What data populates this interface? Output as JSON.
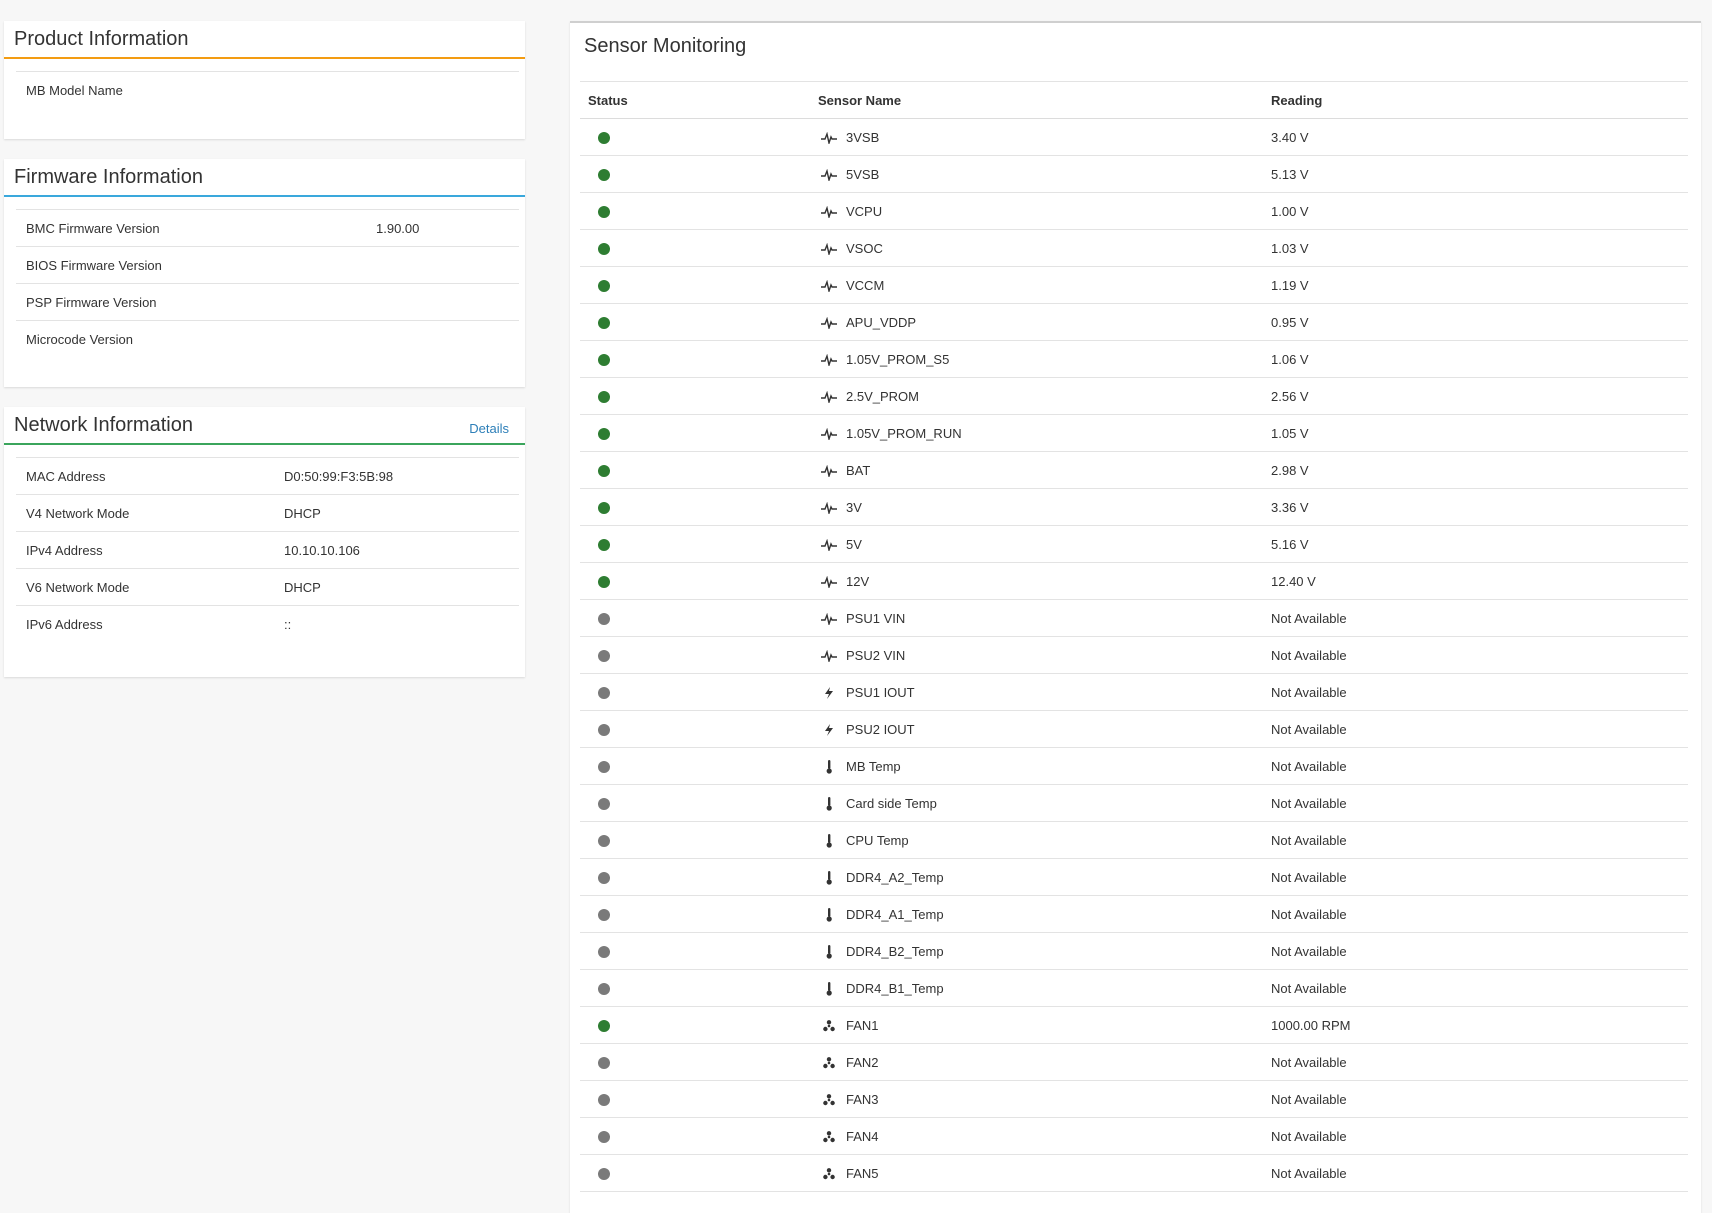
{
  "product": {
    "title": "Product Information",
    "rows": [
      {
        "label": "MB Model Name",
        "value": ""
      }
    ]
  },
  "firmware": {
    "title": "Firmware Information",
    "rows": [
      {
        "label": "BMC Firmware Version",
        "value": "1.90.00"
      },
      {
        "label": "BIOS Firmware Version",
        "value": ""
      },
      {
        "label": "PSP Firmware Version",
        "value": ""
      },
      {
        "label": "Microcode Version",
        "value": ""
      }
    ]
  },
  "network": {
    "title": "Network Information",
    "details_link": "Details",
    "rows": [
      {
        "label": "MAC Address",
        "value": "D0:50:99:F3:5B:98"
      },
      {
        "label": "V4 Network Mode",
        "value": "DHCP"
      },
      {
        "label": "IPv4 Address",
        "value": "10.10.10.106"
      },
      {
        "label": "V6 Network Mode",
        "value": "DHCP"
      },
      {
        "label": "IPv6 Address",
        "value": "::"
      }
    ]
  },
  "sensors": {
    "title": "Sensor Monitoring",
    "columns": {
      "status": "Status",
      "name": "Sensor Name",
      "reading": "Reading"
    },
    "status_colors": {
      "ok": "#2e7d32",
      "na": "#7a7a7a"
    },
    "rows": [
      {
        "status": "ok",
        "icon": "voltage-icon",
        "name": "3VSB",
        "reading": "3.40 V"
      },
      {
        "status": "ok",
        "icon": "voltage-icon",
        "name": "5VSB",
        "reading": "5.13 V"
      },
      {
        "status": "ok",
        "icon": "voltage-icon",
        "name": "VCPU",
        "reading": "1.00 V"
      },
      {
        "status": "ok",
        "icon": "voltage-icon",
        "name": "VSOC",
        "reading": "1.03 V"
      },
      {
        "status": "ok",
        "icon": "voltage-icon",
        "name": "VCCM",
        "reading": "1.19 V"
      },
      {
        "status": "ok",
        "icon": "voltage-icon",
        "name": "APU_VDDP",
        "reading": "0.95 V"
      },
      {
        "status": "ok",
        "icon": "voltage-icon",
        "name": "1.05V_PROM_S5",
        "reading": "1.06 V"
      },
      {
        "status": "ok",
        "icon": "voltage-icon",
        "name": "2.5V_PROM",
        "reading": "2.56 V"
      },
      {
        "status": "ok",
        "icon": "voltage-icon",
        "name": "1.05V_PROM_RUN",
        "reading": "1.05 V"
      },
      {
        "status": "ok",
        "icon": "voltage-icon",
        "name": "BAT",
        "reading": "2.98 V"
      },
      {
        "status": "ok",
        "icon": "voltage-icon",
        "name": "3V",
        "reading": "3.36 V"
      },
      {
        "status": "ok",
        "icon": "voltage-icon",
        "name": "5V",
        "reading": "5.16 V"
      },
      {
        "status": "ok",
        "icon": "voltage-icon",
        "name": "12V",
        "reading": "12.40 V"
      },
      {
        "status": "na",
        "icon": "voltage-icon",
        "name": "PSU1 VIN",
        "reading": "Not Available"
      },
      {
        "status": "na",
        "icon": "voltage-icon",
        "name": "PSU2 VIN",
        "reading": "Not Available"
      },
      {
        "status": "na",
        "icon": "current-icon",
        "name": "PSU1 IOUT",
        "reading": "Not Available"
      },
      {
        "status": "na",
        "icon": "current-icon",
        "name": "PSU2 IOUT",
        "reading": "Not Available"
      },
      {
        "status": "na",
        "icon": "thermometer-icon",
        "name": "MB Temp",
        "reading": "Not Available"
      },
      {
        "status": "na",
        "icon": "thermometer-icon",
        "name": "Card side Temp",
        "reading": "Not Available"
      },
      {
        "status": "na",
        "icon": "thermometer-icon",
        "name": "CPU Temp",
        "reading": "Not Available"
      },
      {
        "status": "na",
        "icon": "thermometer-icon",
        "name": "DDR4_A2_Temp",
        "reading": "Not Available"
      },
      {
        "status": "na",
        "icon": "thermometer-icon",
        "name": "DDR4_A1_Temp",
        "reading": "Not Available"
      },
      {
        "status": "na",
        "icon": "thermometer-icon",
        "name": "DDR4_B2_Temp",
        "reading": "Not Available"
      },
      {
        "status": "na",
        "icon": "thermometer-icon",
        "name": "DDR4_B1_Temp",
        "reading": "Not Available"
      },
      {
        "status": "ok",
        "icon": "fan-icon",
        "name": "FAN1",
        "reading": "1000.00 RPM"
      },
      {
        "status": "na",
        "icon": "fan-icon",
        "name": "FAN2",
        "reading": "Not Available"
      },
      {
        "status": "na",
        "icon": "fan-icon",
        "name": "FAN3",
        "reading": "Not Available"
      },
      {
        "status": "na",
        "icon": "fan-icon",
        "name": "FAN4",
        "reading": "Not Available"
      },
      {
        "status": "na",
        "icon": "fan-icon",
        "name": "FAN5",
        "reading": "Not Available"
      }
    ]
  }
}
